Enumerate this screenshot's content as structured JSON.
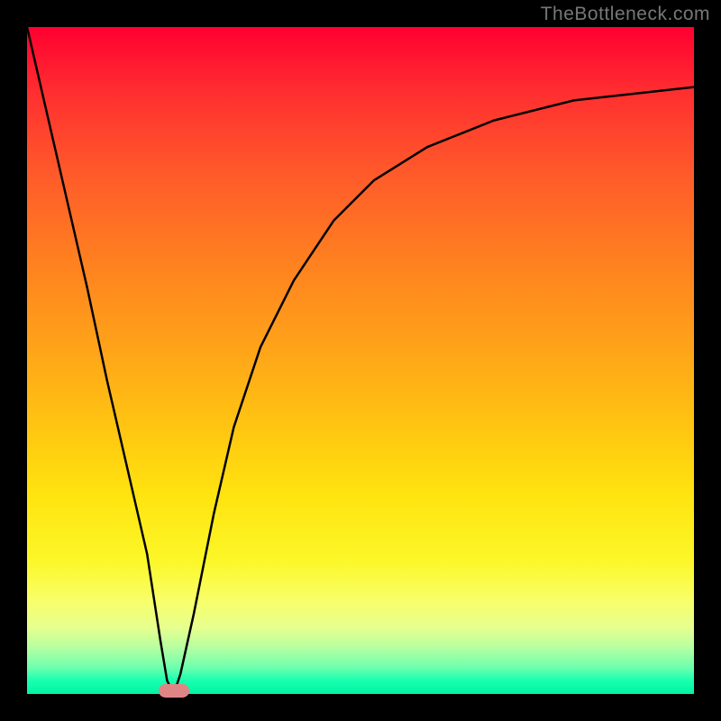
{
  "watermark": "TheBottleneck.com",
  "chart_data": {
    "type": "line",
    "title": "",
    "xlabel": "",
    "ylabel": "",
    "xlim": [
      0,
      100
    ],
    "ylim": [
      0,
      100
    ],
    "series": [
      {
        "name": "bottleneck-curve",
        "x": [
          0,
          3,
          6,
          9,
          12,
          15,
          18,
          20,
          21,
          22,
          23,
          25,
          28,
          31,
          35,
          40,
          46,
          52,
          60,
          70,
          82,
          100
        ],
        "y": [
          100,
          87,
          74,
          61,
          47,
          34,
          21,
          8,
          2,
          0,
          3,
          12,
          27,
          40,
          52,
          62,
          71,
          77,
          82,
          86,
          89,
          91
        ]
      }
    ],
    "marker": {
      "name": "optimal-point",
      "x": 22,
      "y": 0,
      "color": "#e08585"
    },
    "gradient_background": true
  }
}
